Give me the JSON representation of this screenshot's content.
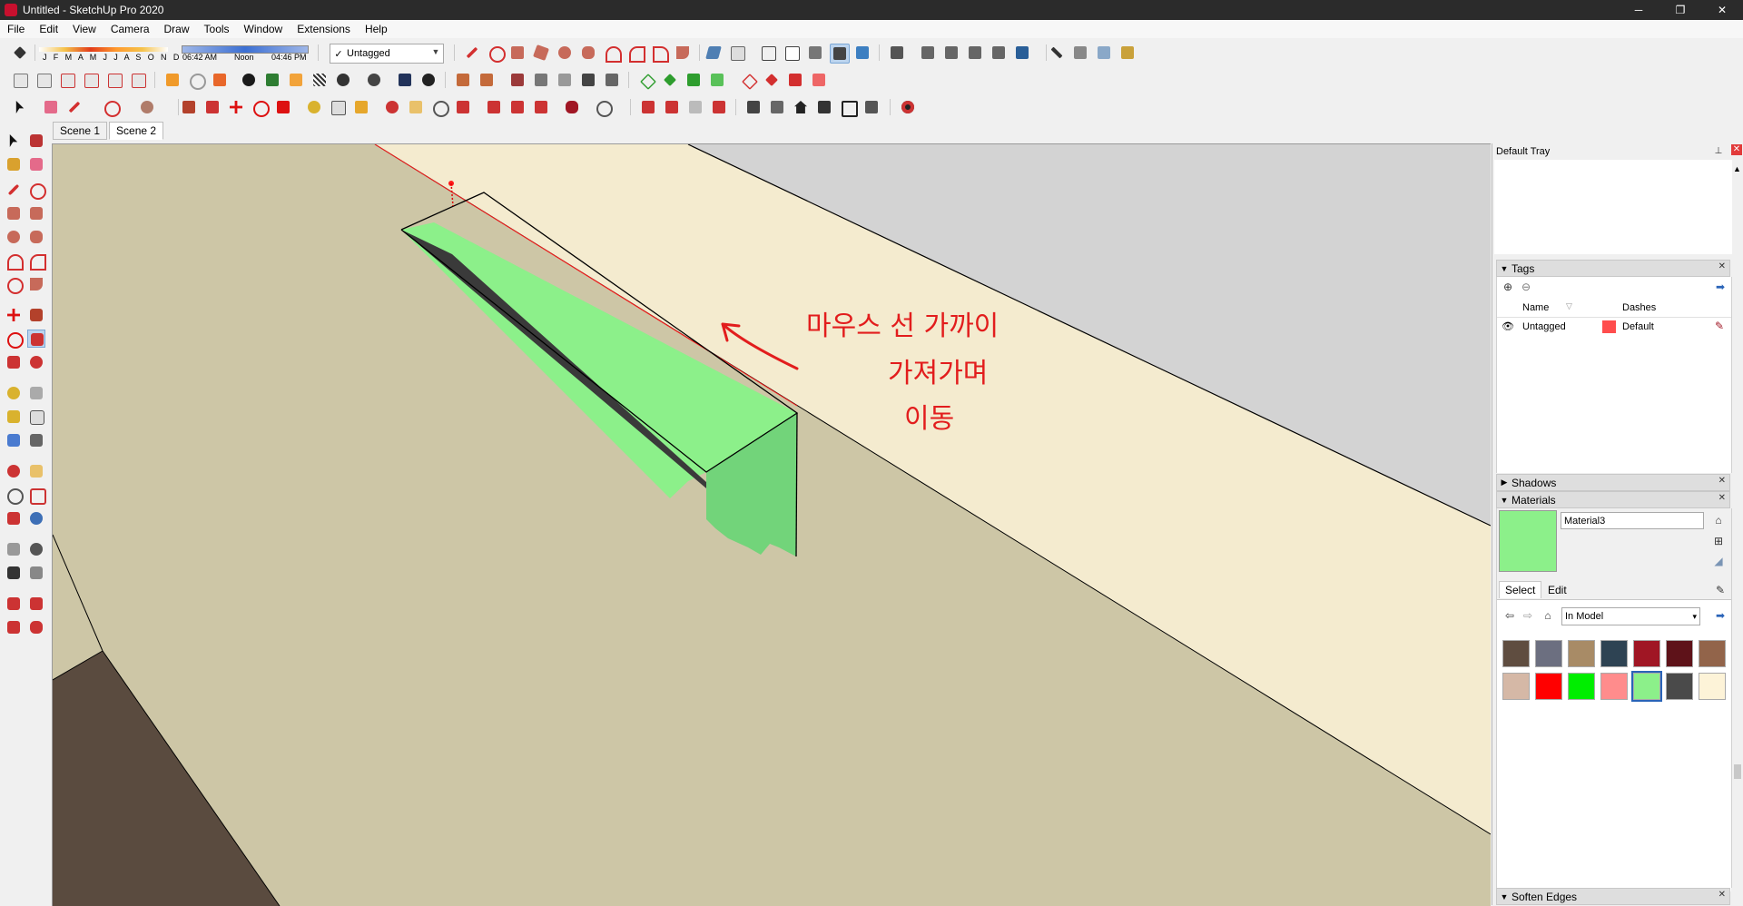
{
  "window": {
    "title": "Untitled - SketchUp Pro 2020",
    "controls": [
      "─",
      "❐",
      "✕"
    ]
  },
  "menu": [
    "File",
    "Edit",
    "View",
    "Camera",
    "Draw",
    "Tools",
    "Window",
    "Extensions",
    "Help"
  ],
  "shadow_toolbar": {
    "months": "J F M A M J J A S O N D",
    "time_start": "06:42 AM",
    "time_noon": "Noon",
    "time_end": "04:46 PM"
  },
  "tag_selector": {
    "value": "Untagged",
    "checked": true
  },
  "scenes": [
    {
      "label": "Scene 1",
      "active": false
    },
    {
      "label": "Scene 2",
      "active": true
    }
  ],
  "annotation": {
    "line1": "마우스 선 가까이",
    "line2": "가져가며",
    "line3": "이동",
    "color": "#e21d1d"
  },
  "colors": {
    "ground": "#cdc6a6",
    "wall": "#f4ebcf",
    "sky": "#d3d3d3",
    "selected_face": "#8cf08a",
    "side_face": "#72d47a",
    "dark_face": "#5a4b3f"
  },
  "tray": {
    "title": "Default Tray",
    "tags_panel": {
      "title": "Tags",
      "expanded": true,
      "col_name": "Name",
      "col_dashes": "Dashes",
      "rows": [
        {
          "name": "Untagged",
          "color": "#ff4d4d",
          "dashes": "Default",
          "visible": true
        }
      ]
    },
    "shadows_panel": {
      "title": "Shadows",
      "expanded": false
    },
    "materials_panel": {
      "title": "Materials",
      "expanded": true,
      "current_name": "Material3",
      "current_color": "#8cf08a",
      "tab_select": "Select",
      "tab_edit": "Edit",
      "library": "In Model",
      "swatches": [
        "#5f4d40",
        "#6c6f80",
        "#a88b66",
        "#2e4353",
        "#a01624",
        "#5e1219",
        "#92644a",
        "#d5b8a6",
        "#ff0000",
        "#00ee00",
        "#ff8c8c",
        "#8cf08a",
        "#4a4a4a",
        "#fdf3d8"
      ],
      "selected_index": 11
    },
    "soften_panel": {
      "title": "Soften Edges",
      "expanded": false
    }
  }
}
